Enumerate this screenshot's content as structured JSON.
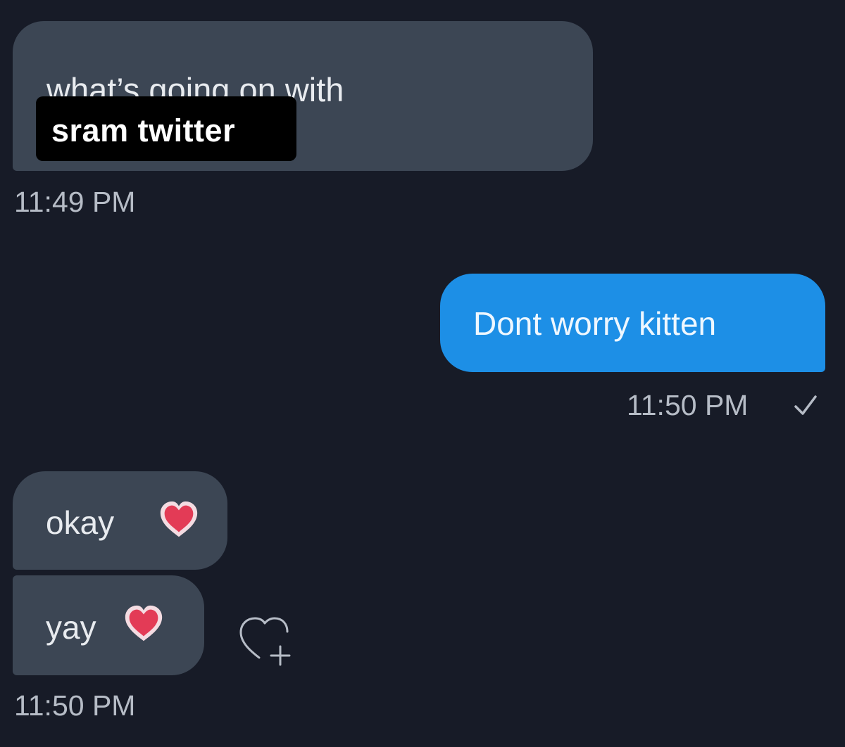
{
  "conversation": {
    "messages": [
      {
        "text": "what’s going on with",
        "overlay": "sram twitter",
        "direction": "received"
      },
      {
        "text": "Dont worry kitten",
        "direction": "sent"
      },
      {
        "text": "okay",
        "direction": "received",
        "emoji": "heart-icon"
      },
      {
        "text": "yay",
        "direction": "received",
        "emoji": "heart-icon"
      }
    ],
    "timestamps": [
      "11:49 PM",
      "11:50 PM",
      "11:50 PM"
    ],
    "sent_status": "check-icon",
    "reaction_action": "add-reaction-icon"
  },
  "colors": {
    "background": "#171b27",
    "received_bubble": "#3c4654",
    "sent_bubble": "#1d8fe6",
    "heart": "#e33b56"
  }
}
